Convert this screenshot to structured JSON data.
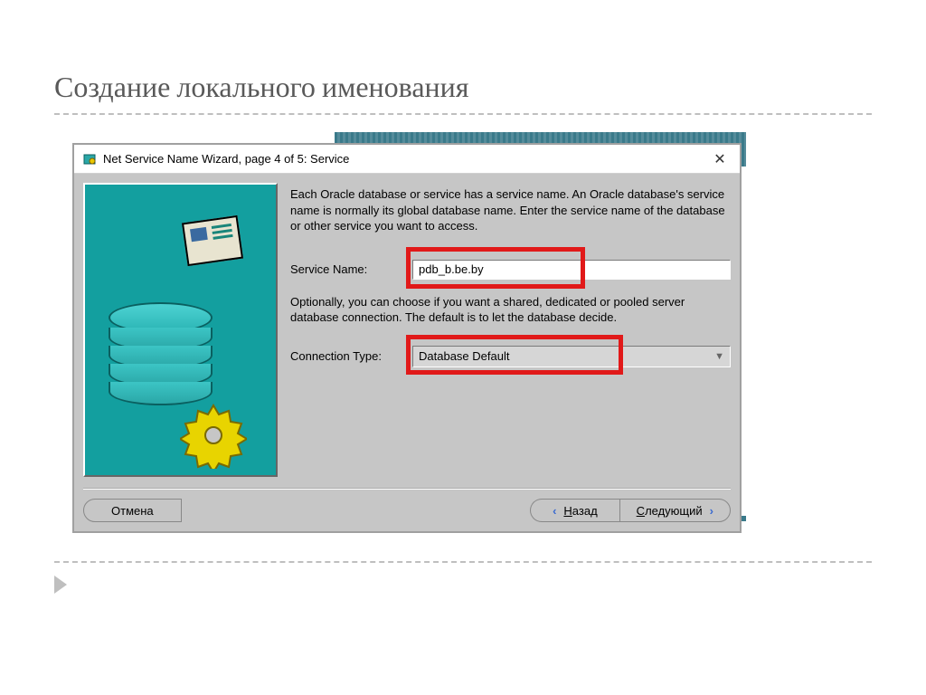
{
  "slide": {
    "title": "Создание локального именования"
  },
  "dialog": {
    "title": "Net Service Name Wizard, page 4 of 5: Service",
    "description": "Each Oracle database or service has a service name. An Oracle database's service name is normally its global database name. Enter the service name of the database or other service you want to access.",
    "serviceName": {
      "label": "Service Name:",
      "value": "pdb_b.be.by"
    },
    "optionalText": "Optionally, you can choose if you want a shared, dedicated or pooled server database connection. The default is to let the database decide.",
    "connectionType": {
      "label": "Connection Type:",
      "value": "Database Default"
    },
    "buttons": {
      "cancel": "Отмена",
      "back": "Назад",
      "next": "Следующий"
    }
  }
}
